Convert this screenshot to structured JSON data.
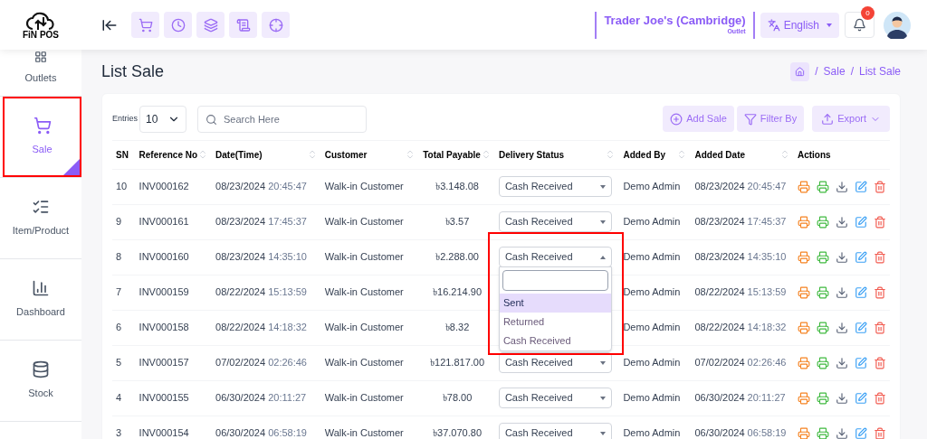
{
  "header": {
    "logo": {
      "word_a": "FiN",
      "word_b": "POS"
    },
    "store": {
      "name": "Trader Joe's (Cambridge)",
      "type": "Outlet"
    },
    "language": "English",
    "notifications": "0"
  },
  "sidebar": {
    "items": [
      {
        "label": "Outlets",
        "selected": false,
        "annotated": false
      },
      {
        "label": "Sale",
        "selected": true,
        "annotated": true
      },
      {
        "label": "Item/Product",
        "selected": false,
        "annotated": false
      },
      {
        "label": "Dashboard",
        "selected": false,
        "annotated": false
      },
      {
        "label": "Stock",
        "selected": false,
        "annotated": false
      }
    ]
  },
  "page": {
    "title": "List Sale",
    "breadcrumb": [
      {
        "separator": "/",
        "label": "Sale"
      },
      {
        "separator": "/",
        "label": "List Sale"
      }
    ]
  },
  "toolbar": {
    "entries_label": "Entries",
    "entries_value": "10",
    "search": {
      "placeholder": "Search Here"
    },
    "buttons": [
      {
        "label": "Add Sale",
        "has_menu": false
      },
      {
        "label": "Filter By",
        "has_menu": false
      },
      {
        "label": "Export",
        "has_menu": true
      }
    ]
  },
  "table": {
    "columns": [
      {
        "label": "SN",
        "sortable": false
      },
      {
        "label": "Reference No",
        "sortable": true
      },
      {
        "label": "Date(Time)",
        "sortable": true
      },
      {
        "label": "Customer",
        "sortable": true
      },
      {
        "label": "Total Payable",
        "sortable": true
      },
      {
        "label": "Delivery Status",
        "sortable": true
      },
      {
        "label": "Added By",
        "sortable": true
      },
      {
        "label": "Added Date",
        "sortable": true
      },
      {
        "label": "Actions",
        "sortable": false
      }
    ],
    "rows": [
      {
        "sn": "10",
        "ref": "INV000162",
        "date": "08/23/2024",
        "time": "20:45:47",
        "customer": "Walk-in Customer",
        "total": "৳3.148.08",
        "delivery_status": "Cash Received",
        "open": false,
        "added_by": "Demo Admin",
        "added_date": "08/23/2024",
        "added_time": "20:45:47"
      },
      {
        "sn": "9",
        "ref": "INV000161",
        "date": "08/23/2024",
        "time": "17:45:37",
        "customer": "Walk-in Customer",
        "total": "৳3.57",
        "delivery_status": "Cash Received",
        "open": false,
        "added_by": "Demo Admin",
        "added_date": "08/23/2024",
        "added_time": "17:45:37"
      },
      {
        "sn": "8",
        "ref": "INV000160",
        "date": "08/23/2024",
        "time": "14:35:10",
        "customer": "Walk-in Customer",
        "total": "৳2.288.00",
        "delivery_status": "Cash Received",
        "open": true,
        "added_by": "Demo Admin",
        "added_date": "08/23/2024",
        "added_time": "14:35:10"
      },
      {
        "sn": "7",
        "ref": "INV000159",
        "date": "08/22/2024",
        "time": "15:13:59",
        "customer": "Walk-in Customer",
        "total": "৳16.214.90",
        "added_by": "Demo Admin",
        "added_date": "08/22/2024",
        "added_time": "15:13:59"
      },
      {
        "sn": "6",
        "ref": "INV000158",
        "date": "08/22/2024",
        "time": "14:18:32",
        "customer": "Walk-in Customer",
        "total": "৳8.32",
        "added_by": "Demo Admin",
        "added_date": "08/22/2024",
        "added_time": "14:18:32"
      },
      {
        "sn": "5",
        "ref": "INV000157",
        "date": "07/02/2024",
        "time": "02:26:46",
        "customer": "Walk-in Customer",
        "total": "৳121.817.00",
        "delivery_status": "Cash Received",
        "open": false,
        "added_by": "Demo Admin",
        "added_date": "07/02/2024",
        "added_time": "02:26:46"
      },
      {
        "sn": "4",
        "ref": "INV000155",
        "date": "06/30/2024",
        "time": "20:11:27",
        "customer": "Walk-in Customer",
        "total": "৳78.00",
        "delivery_status": "Cash Received",
        "open": false,
        "added_by": "Demo Admin",
        "added_date": "06/30/2024",
        "added_time": "20:11:27"
      },
      {
        "sn": "3",
        "ref": "INV000154",
        "date": "06/30/2024",
        "time": "06:58:19",
        "customer": "Walk-in Customer",
        "total": "৳37.070.80",
        "delivery_status": "Cash Received",
        "open": false,
        "added_by": "Demo Admin",
        "added_date": "06/30/2024",
        "added_time": "06:58:19"
      }
    ]
  },
  "status_dropdown": {
    "annotated": true,
    "options": [
      {
        "label": "Sent",
        "selected": true
      },
      {
        "label": "Returned",
        "selected": false
      },
      {
        "label": "Cash Received",
        "selected": false
      }
    ]
  }
}
